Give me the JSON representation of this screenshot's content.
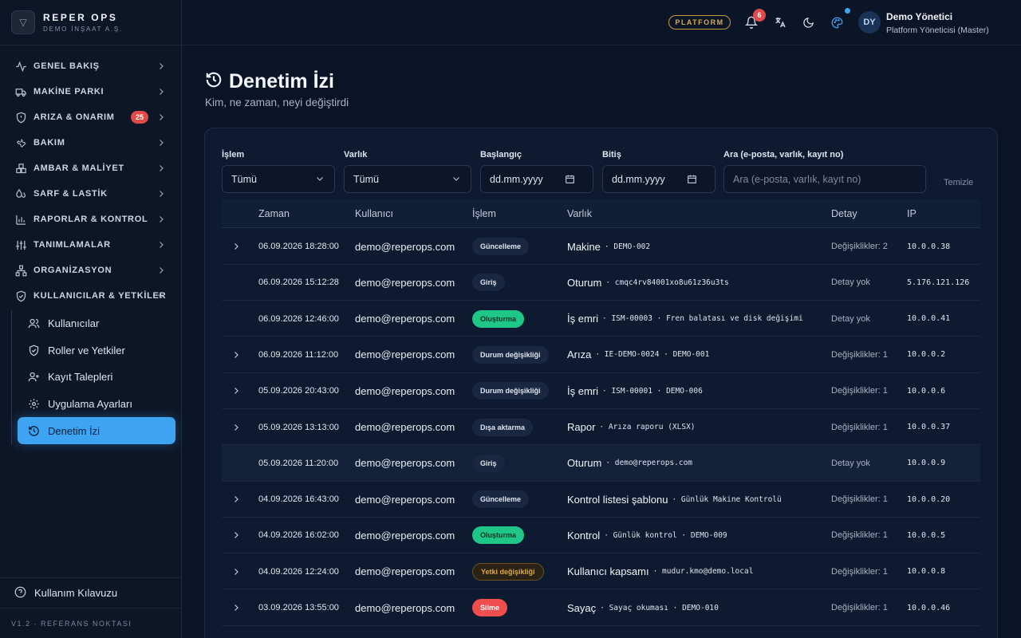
{
  "brand": {
    "title": "REPER OPS",
    "subtitle": "DEMO İNŞAAT A.Ş."
  },
  "sidebar": {
    "items": [
      {
        "label": "GENEL BAKIŞ",
        "icon": "activity-icon"
      },
      {
        "label": "MAKİNE PARKI",
        "icon": "truck-icon"
      },
      {
        "label": "ARIZA & ONARIM",
        "icon": "shield-alert-icon",
        "badge": "25"
      },
      {
        "label": "BAKIM",
        "icon": "wrench-icon"
      },
      {
        "label": "AMBAR & MALİYET",
        "icon": "boxes-icon"
      },
      {
        "label": "SARF & LASTİK",
        "icon": "droplets-icon"
      },
      {
        "label": "RAPORLAR & KONTROL",
        "icon": "bar-chart-icon"
      },
      {
        "label": "TANIMLAMALAR",
        "icon": "sliders-icon"
      },
      {
        "label": "ORGANİZASYON",
        "icon": "org-tree-icon"
      },
      {
        "label": "KULLANICILAR & YETKİLER",
        "icon": "shield-check-icon",
        "expanded": true
      }
    ],
    "subitems": [
      {
        "label": "Kullanıcılar",
        "icon": "users-icon"
      },
      {
        "label": "Roller ve Yetkiler",
        "icon": "shield-check-icon"
      },
      {
        "label": "Kayıt Talepleri",
        "icon": "user-plus-icon"
      },
      {
        "label": "Uygulama Ayarları",
        "icon": "gear-icon"
      },
      {
        "label": "Denetim İzi",
        "icon": "history-icon",
        "active": true
      }
    ],
    "help": "Kullanım Kılavuzu",
    "version": "V1.2 · REFERANS NOKTASI"
  },
  "header": {
    "platform_badge": "PLATFORM",
    "notification_count": "6",
    "user_initials": "DY",
    "user_name": "Demo Yönetici",
    "user_role": "Platform Yöneticisi (Master)"
  },
  "page": {
    "title": "Denetim İzi",
    "subtitle": "Kim, ne zaman, neyi değiştirdi"
  },
  "filters": {
    "operation": {
      "label": "İşlem",
      "value": "Tümü"
    },
    "entity": {
      "label": "Varlık",
      "value": "Tümü"
    },
    "start": {
      "label": "Başlangıç",
      "value": "dd.mm.yyyy"
    },
    "end": {
      "label": "Bitiş",
      "value": "dd.mm.yyyy"
    },
    "search": {
      "label": "Ara (e-posta, varlık, kayıt no)",
      "placeholder": "Ara (e-posta, varlık, kayıt no)"
    },
    "clear": "Temizle"
  },
  "table": {
    "headers": [
      "Zaman",
      "Kullanıcı",
      "İşlem",
      "Varlık",
      "Detay",
      "IP"
    ],
    "rows": [
      {
        "expandable": true,
        "time": "06.09.2026 18:28:00",
        "user": "demo@reperops.com",
        "op": "Güncelleme",
        "op_style": "default",
        "entity": "Makine",
        "entity_ref": "· DEMO-002",
        "detail": "Değişiklikler: 2",
        "ip": "10.0.0.38"
      },
      {
        "expandable": false,
        "time": "06.09.2026 15:12:28",
        "user": "demo@reperops.com",
        "op": "Giriş",
        "op_style": "default",
        "entity": "Oturum",
        "entity_ref": "· cmqc4rv84001xo8u61z36u3ts",
        "detail": "Detay yok",
        "ip": "5.176.121.126"
      },
      {
        "expandable": false,
        "time": "06.09.2026 12:46:00",
        "user": "demo@reperops.com",
        "op": "Oluşturma",
        "op_style": "green",
        "entity": "İş emri",
        "entity_ref": "· ISM-00003 · Fren balatası ve disk değişimi",
        "detail": "Detay yok",
        "ip": "10.0.0.41"
      },
      {
        "expandable": true,
        "time": "06.09.2026 11:12:00",
        "user": "demo@reperops.com",
        "op": "Durum değişikliği",
        "op_style": "default",
        "entity": "Arıza",
        "entity_ref": "· IE-DEMO-0024 · DEMO-001",
        "detail": "Değişiklikler: 1",
        "ip": "10.0.0.2"
      },
      {
        "expandable": true,
        "time": "05.09.2026 20:43:00",
        "user": "demo@reperops.com",
        "op": "Durum değişikliği",
        "op_style": "default",
        "entity": "İş emri",
        "entity_ref": "· ISM-00001 · DEMO-006",
        "detail": "Değişiklikler: 1",
        "ip": "10.0.0.6"
      },
      {
        "expandable": true,
        "time": "05.09.2026 13:13:00",
        "user": "demo@reperops.com",
        "op": "Dışa aktarma",
        "op_style": "default",
        "entity": "Rapor",
        "entity_ref": "· Arıza raporu (XLSX)",
        "detail": "Değişiklikler: 1",
        "ip": "10.0.0.37"
      },
      {
        "expandable": false,
        "time": "05.09.2026 11:20:00",
        "user": "demo@reperops.com",
        "op": "Giriş",
        "op_style": "default",
        "entity": "Oturum",
        "entity_ref": "· demo@reperops.com",
        "detail": "Detay yok",
        "ip": "10.0.0.9",
        "highlight": true
      },
      {
        "expandable": true,
        "time": "04.09.2026 16:43:00",
        "user": "demo@reperops.com",
        "op": "Güncelleme",
        "op_style": "default",
        "entity": "Kontrol listesi şablonu",
        "entity_ref": "· Günlük Makine Kontrolü",
        "detail": "Değişiklikler: 1",
        "ip": "10.0.0.20"
      },
      {
        "expandable": true,
        "time": "04.09.2026 16:02:00",
        "user": "demo@reperops.com",
        "op": "Oluşturma",
        "op_style": "green",
        "entity": "Kontrol",
        "entity_ref": "· Günlük kontrol · DEMO-009",
        "detail": "Değişiklikler: 1",
        "ip": "10.0.0.5"
      },
      {
        "expandable": true,
        "time": "04.09.2026 12:24:00",
        "user": "demo@reperops.com",
        "op": "Yetki değişikliği",
        "op_style": "amber",
        "entity": "Kullanıcı kapsamı",
        "entity_ref": "· mudur.kmo@demo.local",
        "detail": "Değişiklikler: 1",
        "ip": "10.0.0.8"
      },
      {
        "expandable": true,
        "time": "03.09.2026 13:55:00",
        "user": "demo@reperops.com",
        "op": "Silme",
        "op_style": "red",
        "entity": "Sayaç",
        "entity_ref": "· Sayaç okuması · DEMO-010",
        "detail": "Değişiklikler: 1",
        "ip": "10.0.0.46"
      }
    ]
  }
}
